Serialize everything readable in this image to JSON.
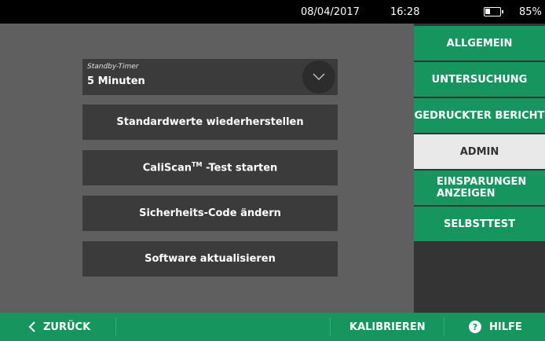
{
  "status": {
    "date": "08/04/2017",
    "time": "16:28",
    "battery_pct": "85%",
    "battery_level": 0.85
  },
  "settings": {
    "standby_label": "Standby-Timer",
    "standby_value": "5 Minuten",
    "restore_defaults": "Standardwerte wiederherstellen",
    "caliscan_prefix": "CaliScan",
    "caliscan_tm": "TM",
    "caliscan_suffix": " -Test starten",
    "change_code": "Sicherheits-Code ändern",
    "update_software": "Software aktualisieren"
  },
  "nav": {
    "items": [
      {
        "label": "ALLGEMEIN",
        "active": false
      },
      {
        "label": "UNTERSUCHUNG",
        "active": false
      },
      {
        "label": "GEDRUCKTER BERICHT",
        "active": false
      },
      {
        "label": "ADMIN",
        "active": true
      },
      {
        "label": "EINSPARUNGEN ANZEIGEN",
        "active": false
      },
      {
        "label": "SELBSTTEST",
        "active": false
      }
    ]
  },
  "bottom": {
    "back": "ZURÜCK",
    "calibrate": "KALIBRIEREN",
    "help": "HILFE",
    "help_glyph": "?"
  },
  "colors": {
    "accent": "#16955f",
    "active_tab": "#e9e9e9",
    "panel": "#5f5f5f",
    "button": "#3b3b3b"
  }
}
